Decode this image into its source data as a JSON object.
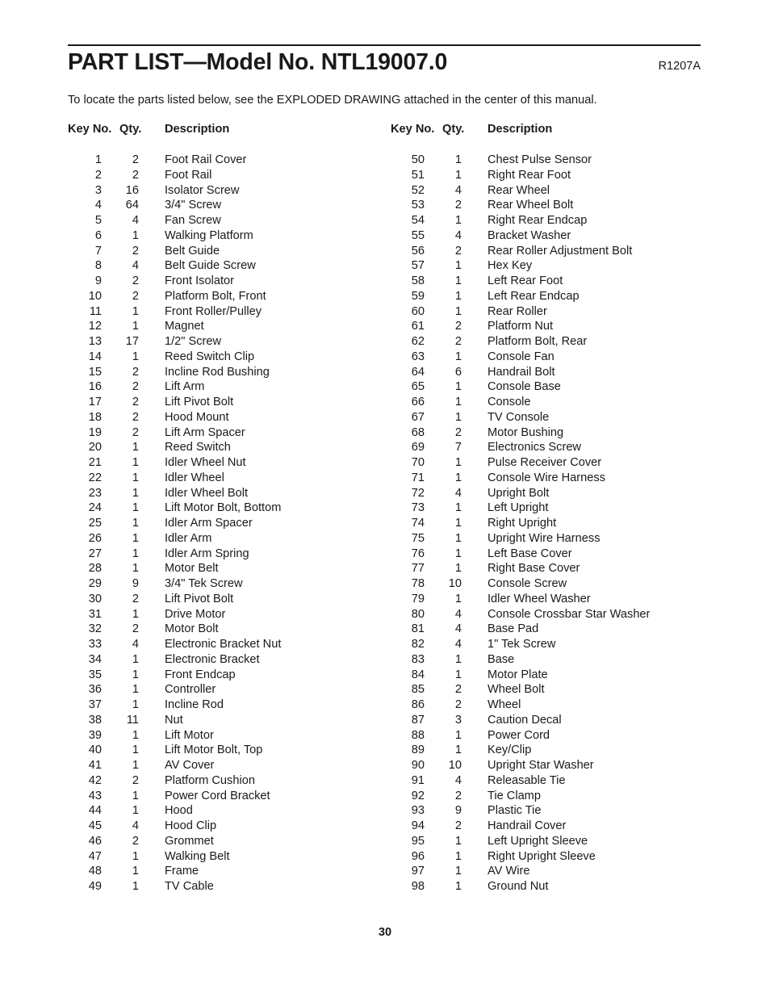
{
  "document": {
    "title": "PART LIST—Model No. NTL19007.0",
    "revision": "R1207A",
    "intro": "To locate the parts listed below, see the EXPLODED DRAWING attached in the center of this manual.",
    "page_number": "30"
  },
  "table": {
    "headers": {
      "key_no": "Key No.",
      "qty": "Qty.",
      "description": "Description"
    },
    "left_column": [
      {
        "key": "1",
        "qty": "2",
        "desc": "Foot Rail Cover"
      },
      {
        "key": "2",
        "qty": "2",
        "desc": "Foot Rail"
      },
      {
        "key": "3",
        "qty": "16",
        "desc": "Isolator Screw"
      },
      {
        "key": "4",
        "qty": "64",
        "desc": "3/4\" Screw"
      },
      {
        "key": "5",
        "qty": "4",
        "desc": "Fan Screw"
      },
      {
        "key": "6",
        "qty": "1",
        "desc": "Walking Platform"
      },
      {
        "key": "7",
        "qty": "2",
        "desc": "Belt Guide"
      },
      {
        "key": "8",
        "qty": "4",
        "desc": "Belt Guide Screw"
      },
      {
        "key": "9",
        "qty": "2",
        "desc": "Front Isolator"
      },
      {
        "key": "10",
        "qty": "2",
        "desc": "Platform Bolt, Front"
      },
      {
        "key": "11",
        "qty": "1",
        "desc": "Front Roller/Pulley"
      },
      {
        "key": "12",
        "qty": "1",
        "desc": "Magnet"
      },
      {
        "key": "13",
        "qty": "17",
        "desc": "1/2\" Screw"
      },
      {
        "key": "14",
        "qty": "1",
        "desc": "Reed Switch Clip"
      },
      {
        "key": "15",
        "qty": "2",
        "desc": "Incline Rod Bushing"
      },
      {
        "key": "16",
        "qty": "2",
        "desc": "Lift Arm"
      },
      {
        "key": "17",
        "qty": "2",
        "desc": "Lift Pivot Bolt"
      },
      {
        "key": "18",
        "qty": "2",
        "desc": "Hood Mount"
      },
      {
        "key": "19",
        "qty": "2",
        "desc": "Lift Arm Spacer"
      },
      {
        "key": "20",
        "qty": "1",
        "desc": "Reed Switch"
      },
      {
        "key": "21",
        "qty": "1",
        "desc": "Idler Wheel Nut"
      },
      {
        "key": "22",
        "qty": "1",
        "desc": "Idler Wheel"
      },
      {
        "key": "23",
        "qty": "1",
        "desc": "Idler Wheel Bolt"
      },
      {
        "key": "24",
        "qty": "1",
        "desc": "Lift Motor Bolt, Bottom"
      },
      {
        "key": "25",
        "qty": "1",
        "desc": "Idler Arm Spacer"
      },
      {
        "key": "26",
        "qty": "1",
        "desc": "Idler Arm"
      },
      {
        "key": "27",
        "qty": "1",
        "desc": "Idler Arm Spring"
      },
      {
        "key": "28",
        "qty": "1",
        "desc": "Motor Belt"
      },
      {
        "key": "29",
        "qty": "9",
        "desc": "3/4\" Tek Screw"
      },
      {
        "key": "30",
        "qty": "2",
        "desc": "Lift Pivot Bolt"
      },
      {
        "key": "31",
        "qty": "1",
        "desc": "Drive Motor"
      },
      {
        "key": "32",
        "qty": "2",
        "desc": "Motor Bolt"
      },
      {
        "key": "33",
        "qty": "4",
        "desc": "Electronic Bracket Nut"
      },
      {
        "key": "34",
        "qty": "1",
        "desc": "Electronic Bracket"
      },
      {
        "key": "35",
        "qty": "1",
        "desc": "Front Endcap"
      },
      {
        "key": "36",
        "qty": "1",
        "desc": "Controller"
      },
      {
        "key": "37",
        "qty": "1",
        "desc": "Incline Rod"
      },
      {
        "key": "38",
        "qty": "11",
        "desc": "Nut"
      },
      {
        "key": "39",
        "qty": "1",
        "desc": "Lift Motor"
      },
      {
        "key": "40",
        "qty": "1",
        "desc": "Lift Motor Bolt, Top"
      },
      {
        "key": "41",
        "qty": "1",
        "desc": "AV Cover"
      },
      {
        "key": "42",
        "qty": "2",
        "desc": "Platform Cushion"
      },
      {
        "key": "43",
        "qty": "1",
        "desc": "Power Cord Bracket"
      },
      {
        "key": "44",
        "qty": "1",
        "desc": "Hood"
      },
      {
        "key": "45",
        "qty": "4",
        "desc": "Hood Clip"
      },
      {
        "key": "46",
        "qty": "2",
        "desc": "Grommet"
      },
      {
        "key": "47",
        "qty": "1",
        "desc": "Walking Belt"
      },
      {
        "key": "48",
        "qty": "1",
        "desc": "Frame"
      },
      {
        "key": "49",
        "qty": "1",
        "desc": "TV Cable"
      }
    ],
    "right_column": [
      {
        "key": "50",
        "qty": "1",
        "desc": "Chest Pulse Sensor"
      },
      {
        "key": "51",
        "qty": "1",
        "desc": "Right Rear Foot"
      },
      {
        "key": "52",
        "qty": "4",
        "desc": "Rear Wheel"
      },
      {
        "key": "53",
        "qty": "2",
        "desc": "Rear Wheel Bolt"
      },
      {
        "key": "54",
        "qty": "1",
        "desc": "Right Rear Endcap"
      },
      {
        "key": "55",
        "qty": "4",
        "desc": "Bracket Washer"
      },
      {
        "key": "56",
        "qty": "2",
        "desc": "Rear Roller Adjustment Bolt"
      },
      {
        "key": "57",
        "qty": "1",
        "desc": "Hex Key"
      },
      {
        "key": "58",
        "qty": "1",
        "desc": "Left Rear Foot"
      },
      {
        "key": "59",
        "qty": "1",
        "desc": "Left Rear Endcap"
      },
      {
        "key": "60",
        "qty": "1",
        "desc": "Rear Roller"
      },
      {
        "key": "61",
        "qty": "2",
        "desc": "Platform Nut"
      },
      {
        "key": "62",
        "qty": "2",
        "desc": "Platform Bolt, Rear"
      },
      {
        "key": "63",
        "qty": "1",
        "desc": "Console Fan"
      },
      {
        "key": "64",
        "qty": "6",
        "desc": "Handrail Bolt"
      },
      {
        "key": "65",
        "qty": "1",
        "desc": "Console Base"
      },
      {
        "key": "66",
        "qty": "1",
        "desc": "Console"
      },
      {
        "key": "67",
        "qty": "1",
        "desc": "TV Console"
      },
      {
        "key": "68",
        "qty": "2",
        "desc": "Motor Bushing"
      },
      {
        "key": "69",
        "qty": "7",
        "desc": "Electronics Screw"
      },
      {
        "key": "70",
        "qty": "1",
        "desc": "Pulse Receiver Cover"
      },
      {
        "key": "71",
        "qty": "1",
        "desc": "Console Wire Harness"
      },
      {
        "key": "72",
        "qty": "4",
        "desc": "Upright Bolt"
      },
      {
        "key": "73",
        "qty": "1",
        "desc": "Left Upright"
      },
      {
        "key": "74",
        "qty": "1",
        "desc": "Right Upright"
      },
      {
        "key": "75",
        "qty": "1",
        "desc": "Upright Wire Harness"
      },
      {
        "key": "76",
        "qty": "1",
        "desc": "Left Base Cover"
      },
      {
        "key": "77",
        "qty": "1",
        "desc": "Right Base Cover"
      },
      {
        "key": "78",
        "qty": "10",
        "desc": "Console Screw"
      },
      {
        "key": "79",
        "qty": "1",
        "desc": "Idler Wheel Washer"
      },
      {
        "key": "80",
        "qty": "4",
        "desc": "Console Crossbar Star Washer"
      },
      {
        "key": "81",
        "qty": "4",
        "desc": "Base Pad"
      },
      {
        "key": "82",
        "qty": "4",
        "desc": "1\" Tek Screw"
      },
      {
        "key": "83",
        "qty": "1",
        "desc": "Base"
      },
      {
        "key": "84",
        "qty": "1",
        "desc": "Motor Plate"
      },
      {
        "key": "85",
        "qty": "2",
        "desc": "Wheel Bolt"
      },
      {
        "key": "86",
        "qty": "2",
        "desc": "Wheel"
      },
      {
        "key": "87",
        "qty": "3",
        "desc": "Caution Decal"
      },
      {
        "key": "88",
        "qty": "1",
        "desc": "Power Cord"
      },
      {
        "key": "89",
        "qty": "1",
        "desc": "Key/Clip"
      },
      {
        "key": "90",
        "qty": "10",
        "desc": "Upright Star Washer"
      },
      {
        "key": "91",
        "qty": "4",
        "desc": "Releasable Tie"
      },
      {
        "key": "92",
        "qty": "2",
        "desc": "Tie Clamp"
      },
      {
        "key": "93",
        "qty": "9",
        "desc": "Plastic Tie"
      },
      {
        "key": "94",
        "qty": "2",
        "desc": "Handrail Cover"
      },
      {
        "key": "95",
        "qty": "1",
        "desc": "Left Upright Sleeve"
      },
      {
        "key": "96",
        "qty": "1",
        "desc": "Right Upright Sleeve"
      },
      {
        "key": "97",
        "qty": "1",
        "desc": "AV Wire"
      },
      {
        "key": "98",
        "qty": "1",
        "desc": "Ground Nut"
      }
    ]
  }
}
